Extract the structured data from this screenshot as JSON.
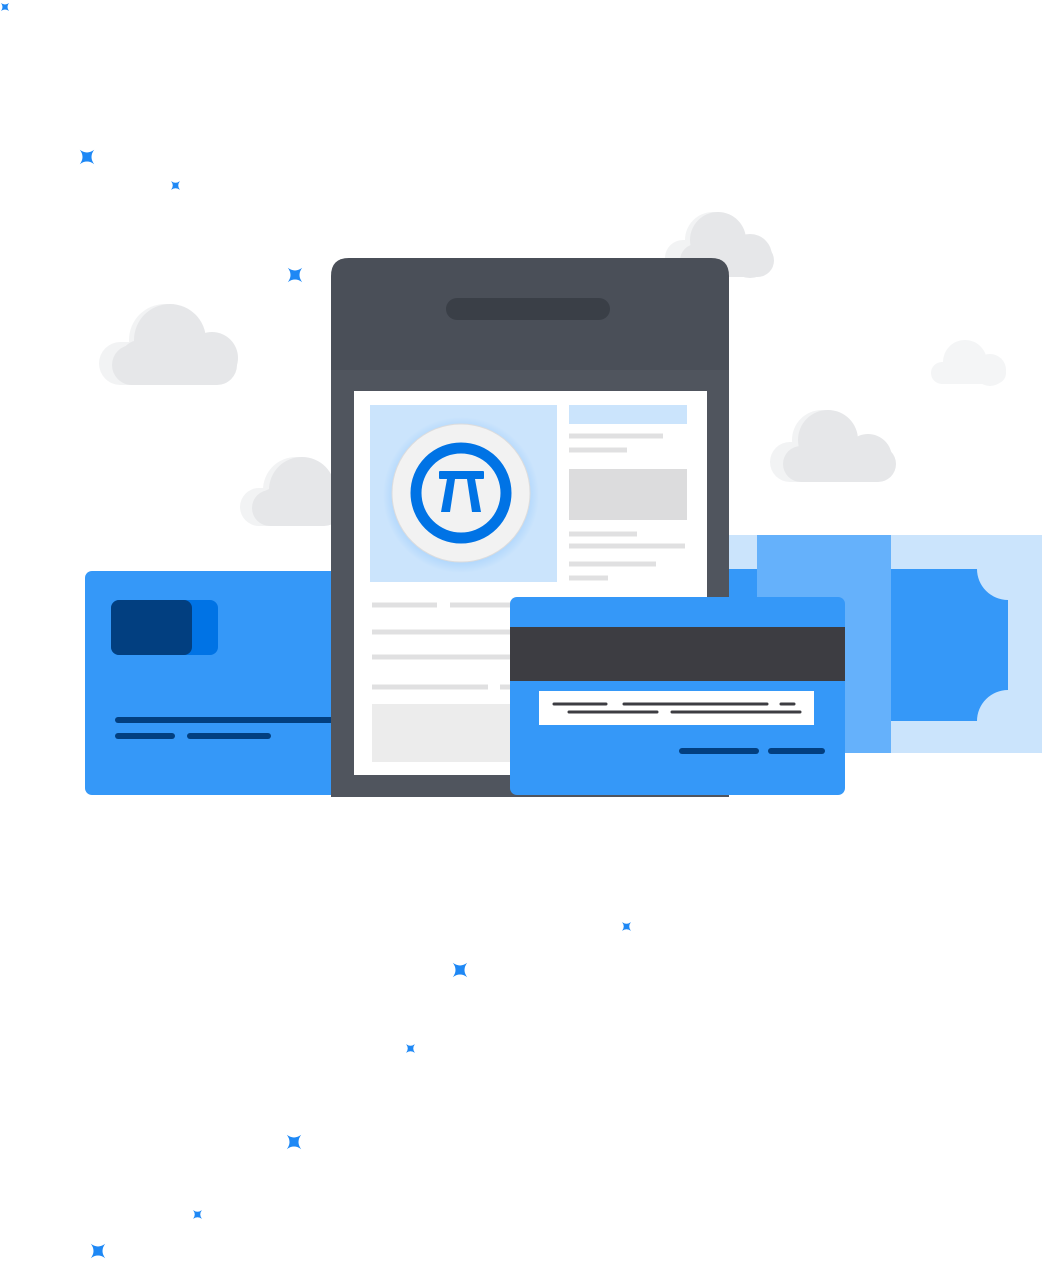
{
  "illustration": {
    "subject": "payment",
    "logo_icon": "pi-icon",
    "colors": {
      "primary_blue": "#3598f8",
      "light_blue": "#cbe4fc",
      "mid_blue": "#65b1fb",
      "navy": "#023f80",
      "chip_accent": "#0073e5",
      "device_dark": "#4a4f58",
      "device_notch": "#3a3f47",
      "mag_stripe": "#3d3d42",
      "cloud": "#e6e7e9",
      "sparkle": "#1e88f5",
      "paper": "#ffffff",
      "placeholder_gray": "#dcdcdd"
    }
  }
}
